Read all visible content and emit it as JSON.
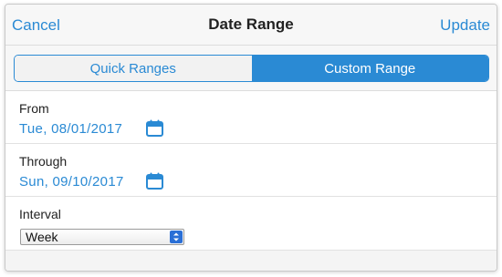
{
  "header": {
    "cancel_label": "Cancel",
    "title": "Date Range",
    "update_label": "Update"
  },
  "tabs": [
    {
      "label": "Quick Ranges",
      "active": false
    },
    {
      "label": "Custom Range",
      "active": true
    }
  ],
  "form": {
    "from": {
      "label": "From",
      "value": "Tue, 08/01/2017",
      "icon": "calendar-icon"
    },
    "through": {
      "label": "Through",
      "value": "Sun, 09/10/2017",
      "icon": "calendar-icon"
    },
    "interval": {
      "label": "Interval",
      "selected": "Week"
    }
  },
  "colors": {
    "accent": "#2a8ad4",
    "header_bg": "#f7f7f7"
  }
}
